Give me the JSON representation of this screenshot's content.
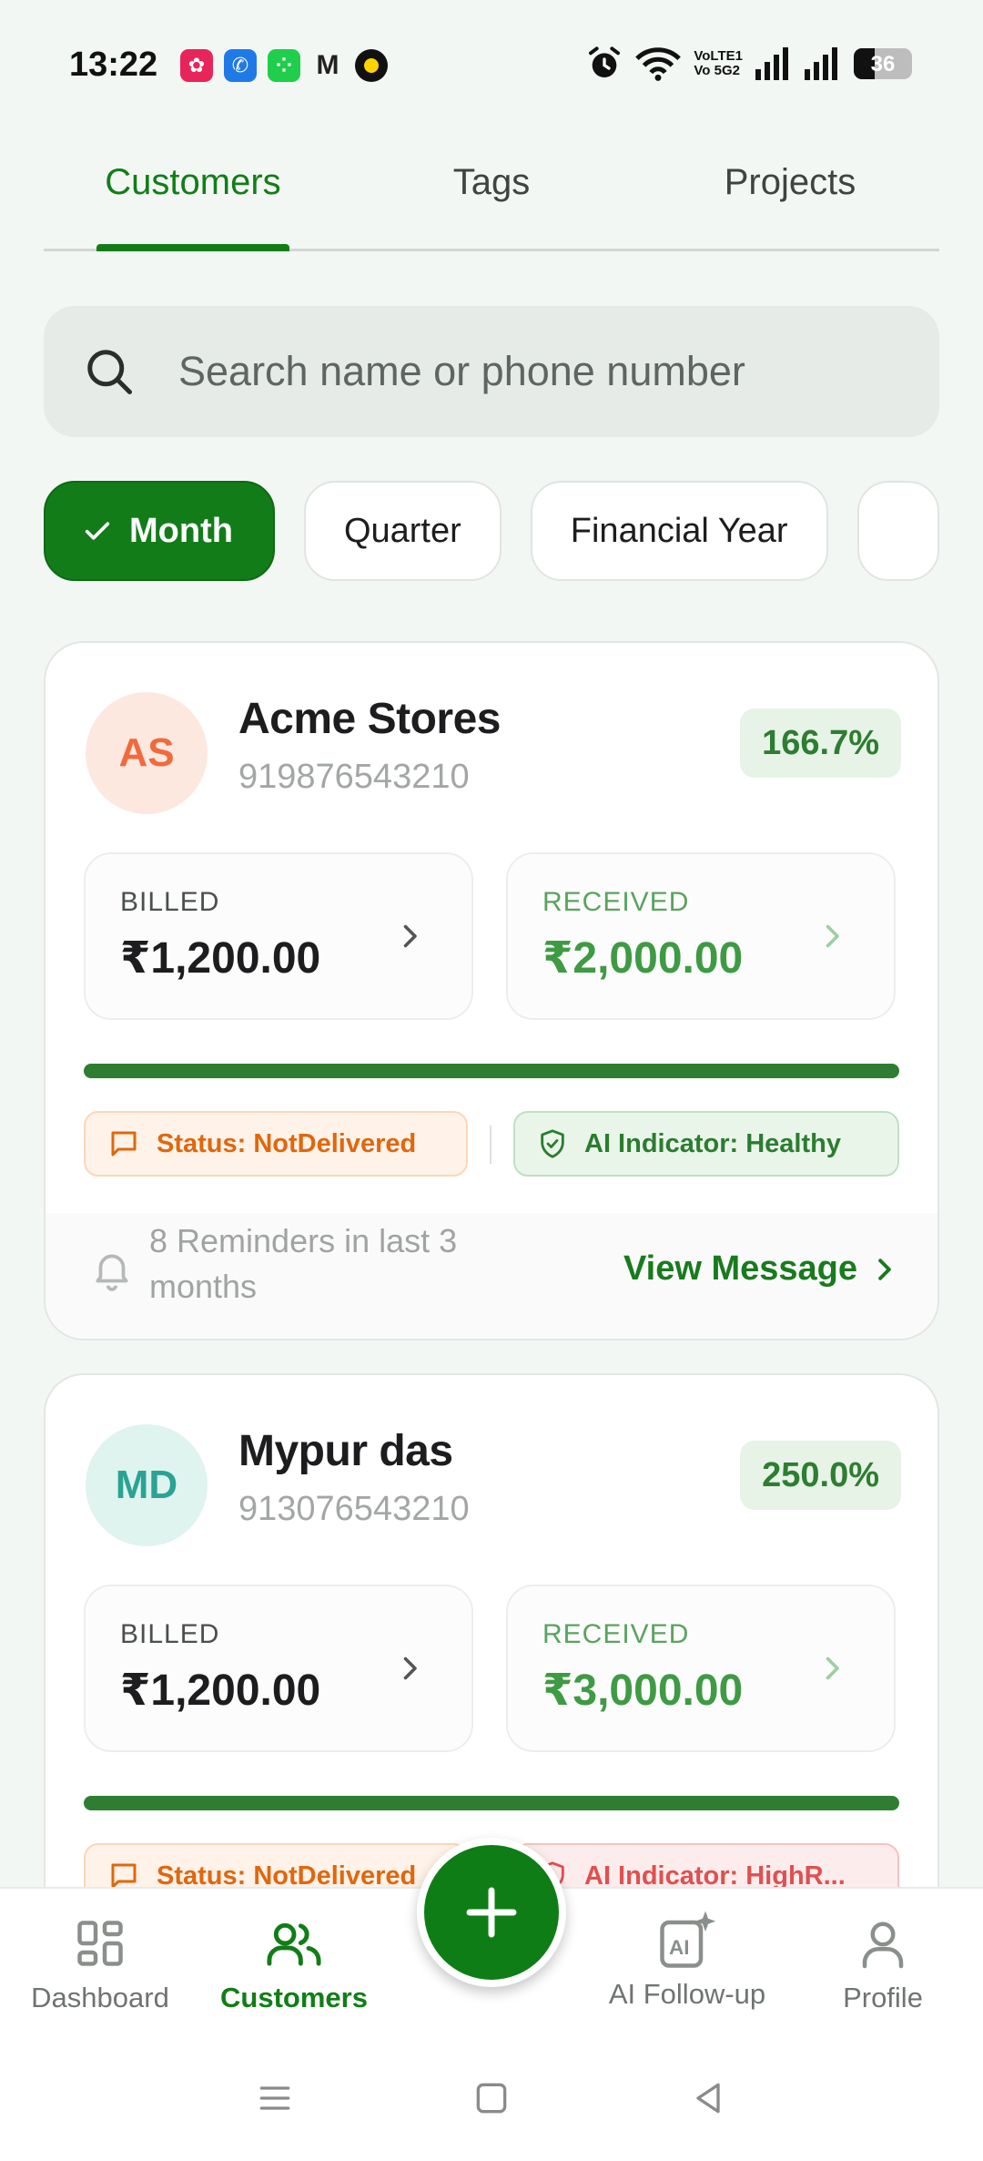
{
  "status_bar": {
    "time": "13:22",
    "volte_line1": "VoLTE1",
    "volte_line2": "Vo 5G2",
    "battery": "36"
  },
  "tabs": [
    {
      "label": "Customers",
      "active": true
    },
    {
      "label": "Tags",
      "active": false
    },
    {
      "label": "Projects",
      "active": false
    }
  ],
  "search": {
    "placeholder": "Search name or phone number",
    "value": ""
  },
  "filters": [
    {
      "label": "Month",
      "selected": true
    },
    {
      "label": "Quarter",
      "selected": false
    },
    {
      "label": "Financial Year",
      "selected": false
    }
  ],
  "customers": [
    {
      "initials": "AS",
      "name": "Acme Stores",
      "phone": "919876543210",
      "percent": "166.7%",
      "billed_label": "BILLED",
      "billed": "₹1,200.00",
      "received_label": "RECEIVED",
      "received": "₹2,000.00",
      "progress": 1.0,
      "status": "Status: NotDelivered",
      "ai_indicator": "AI Indicator: Healthy",
      "reminders": "8 Reminders in last 3 months",
      "view_message": "View Message",
      "avatar_bg": "#fde8e0",
      "avatar_color": "#f06a3c"
    },
    {
      "initials": "MD",
      "name": "Mypur das",
      "phone": "913076543210",
      "percent": "250.0%",
      "billed_label": "BILLED",
      "billed": "₹1,200.00",
      "received_label": "RECEIVED",
      "received": "₹3,000.00",
      "progress": 1.0,
      "status": "Status: NotDelivered",
      "ai_indicator": "AI Indicator: HighR...",
      "avatar_bg": "#dff3ef",
      "avatar_color": "#2aa394"
    }
  ],
  "bottom_nav": [
    {
      "label": "Dashboard",
      "active": false
    },
    {
      "label": "Customers",
      "active": true
    },
    {
      "label": "AI Follow-up",
      "active": false
    },
    {
      "label": "Profile",
      "active": false
    }
  ],
  "colors": {
    "brand_green": "#127d18",
    "status_orange": "#e0670e",
    "ai_healthy": "#2b7d2f",
    "ai_risk": "#e05050"
  }
}
